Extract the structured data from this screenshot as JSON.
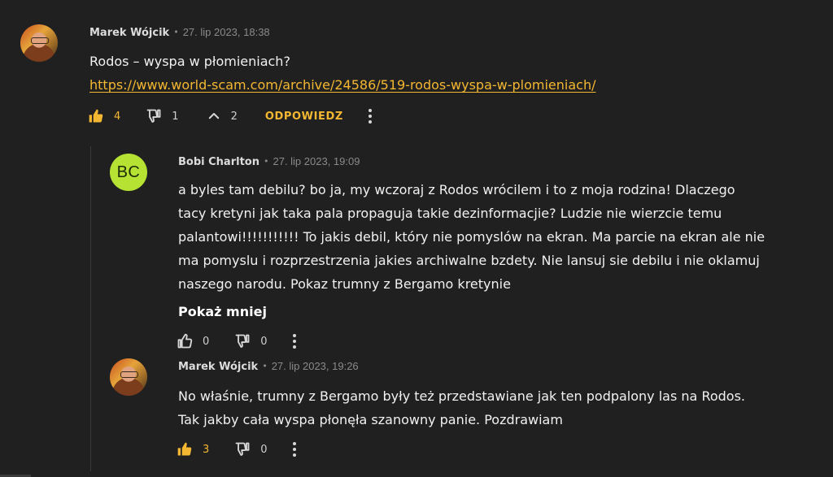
{
  "comments": [
    {
      "author": "Marek Wójcik",
      "timestamp": "27. lip 2023, 18:38",
      "text_lines": [
        "Rodos – wyspa w płomieniach?"
      ],
      "link": "https://www.world-scam.com/archive/24586/519-rodos-wyspa-w-plomieniach/",
      "likes": "4",
      "dislikes": "1",
      "replies_count": "2",
      "reply_label": "ODPOWIEDZ",
      "liked": true
    },
    {
      "author": "Bobi Charlton",
      "avatar_initials": "BC",
      "avatar_color": "#b6e234",
      "timestamp": "27. lip 2023, 19:09",
      "text_lines": [
        "a byles tam debilu? bo ja, my wczoraj z Rodos wrócilem i to z moja rodzina! Dlaczego",
        "tacy kretyni jak taka pala propaguja takie dezinformacjie? Ludzie nie wierzcie temu",
        "palantowi!!!!!!!!!!! To jakis debil, który nie pomyslów na ekran. Ma parcie na ekran ale nie",
        "ma pomyslu i rozprzestrzenia jakies archiwalne bzdety. Nie lansuj sie debilu i nie oklamuj",
        "naszego narodu. Pokaz trumny z Bergamo kretynie"
      ],
      "show_less": "Pokaż mniej",
      "likes": "0",
      "dislikes": "0",
      "liked": false
    },
    {
      "author": "Marek Wójcik",
      "timestamp": "27. lip 2023, 19:26",
      "text_lines": [
        "No właśnie, trumny z Bergamo były też przedstawiane jak ten podpalony las na Rodos.",
        "Tak jakby cała wyspa płonęła szanowny panie. Pozdrawiam"
      ],
      "likes": "3",
      "dislikes": "0",
      "liked": true
    }
  ],
  "colors": {
    "background": "#202020",
    "accent": "#f4b731",
    "muted": "#8a8a8a"
  },
  "icons": [
    "thumbs-up-icon",
    "thumbs-down-icon",
    "chevron-up-icon",
    "more-vertical-icon"
  ]
}
